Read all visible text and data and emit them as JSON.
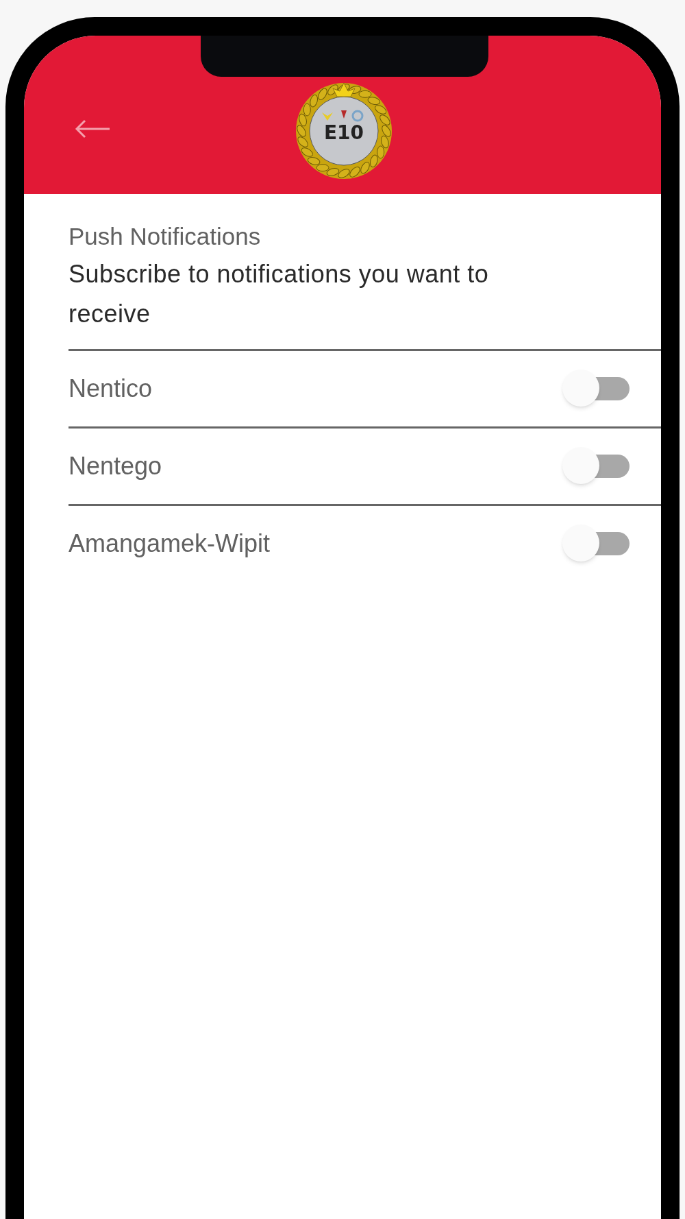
{
  "header": {
    "logo_text": "E10"
  },
  "section": {
    "title": "Push Notifications",
    "subtitle": "Subscribe to notifications you want to receive"
  },
  "subscriptions": [
    {
      "label": "Nentico",
      "on": false
    },
    {
      "label": "Nentego",
      "on": false
    },
    {
      "label": "Amangamek-Wipit",
      "on": false
    }
  ]
}
